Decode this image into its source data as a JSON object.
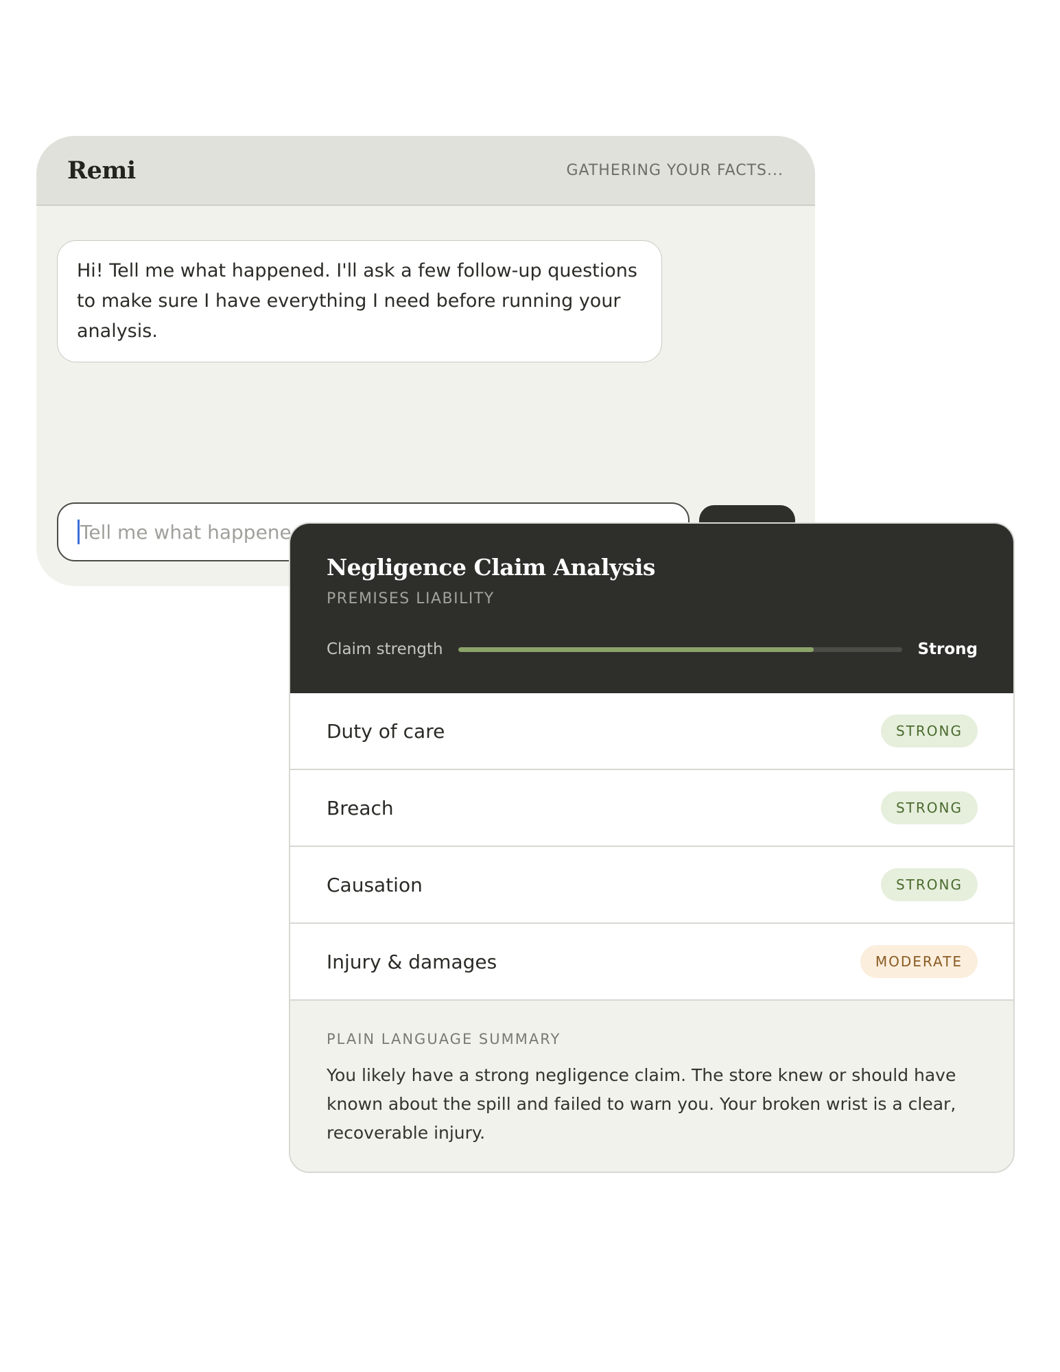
{
  "chat": {
    "brand": "Remi",
    "status": "GATHERING YOUR FACTS...",
    "message": "Hi! Tell me what happened. I'll ask a few follow-up questions to make sure I have everything I need before running your analysis.",
    "input_placeholder": "Tell me what happened"
  },
  "analysis": {
    "title": "Negligence Claim Analysis",
    "subtitle": "PREMISES LIABILITY",
    "strength_label": "Claim strength",
    "strength_value": "Strong",
    "strength_level": 0.8,
    "elements": [
      {
        "label": "Duty of care",
        "rating": "STRONG",
        "level": "strong"
      },
      {
        "label": "Breach",
        "rating": "STRONG",
        "level": "strong"
      },
      {
        "label": "Causation",
        "rating": "STRONG",
        "level": "strong"
      },
      {
        "label": "Injury & damages",
        "rating": "MODERATE",
        "level": "moderate"
      }
    ],
    "summary_label": "PLAIN LANGUAGE SUMMARY",
    "summary_text": "You likely have a strong negligence claim. The store knew or should have known about the spill and failed to warn you. Your broken wrist is a clear, recoverable injury."
  },
  "colors": {
    "accent_bar": "#8aa36a",
    "dark_header": "#2e2e2a",
    "badge_strong": "#e6efdc",
    "badge_moderate": "#fbeedd"
  }
}
